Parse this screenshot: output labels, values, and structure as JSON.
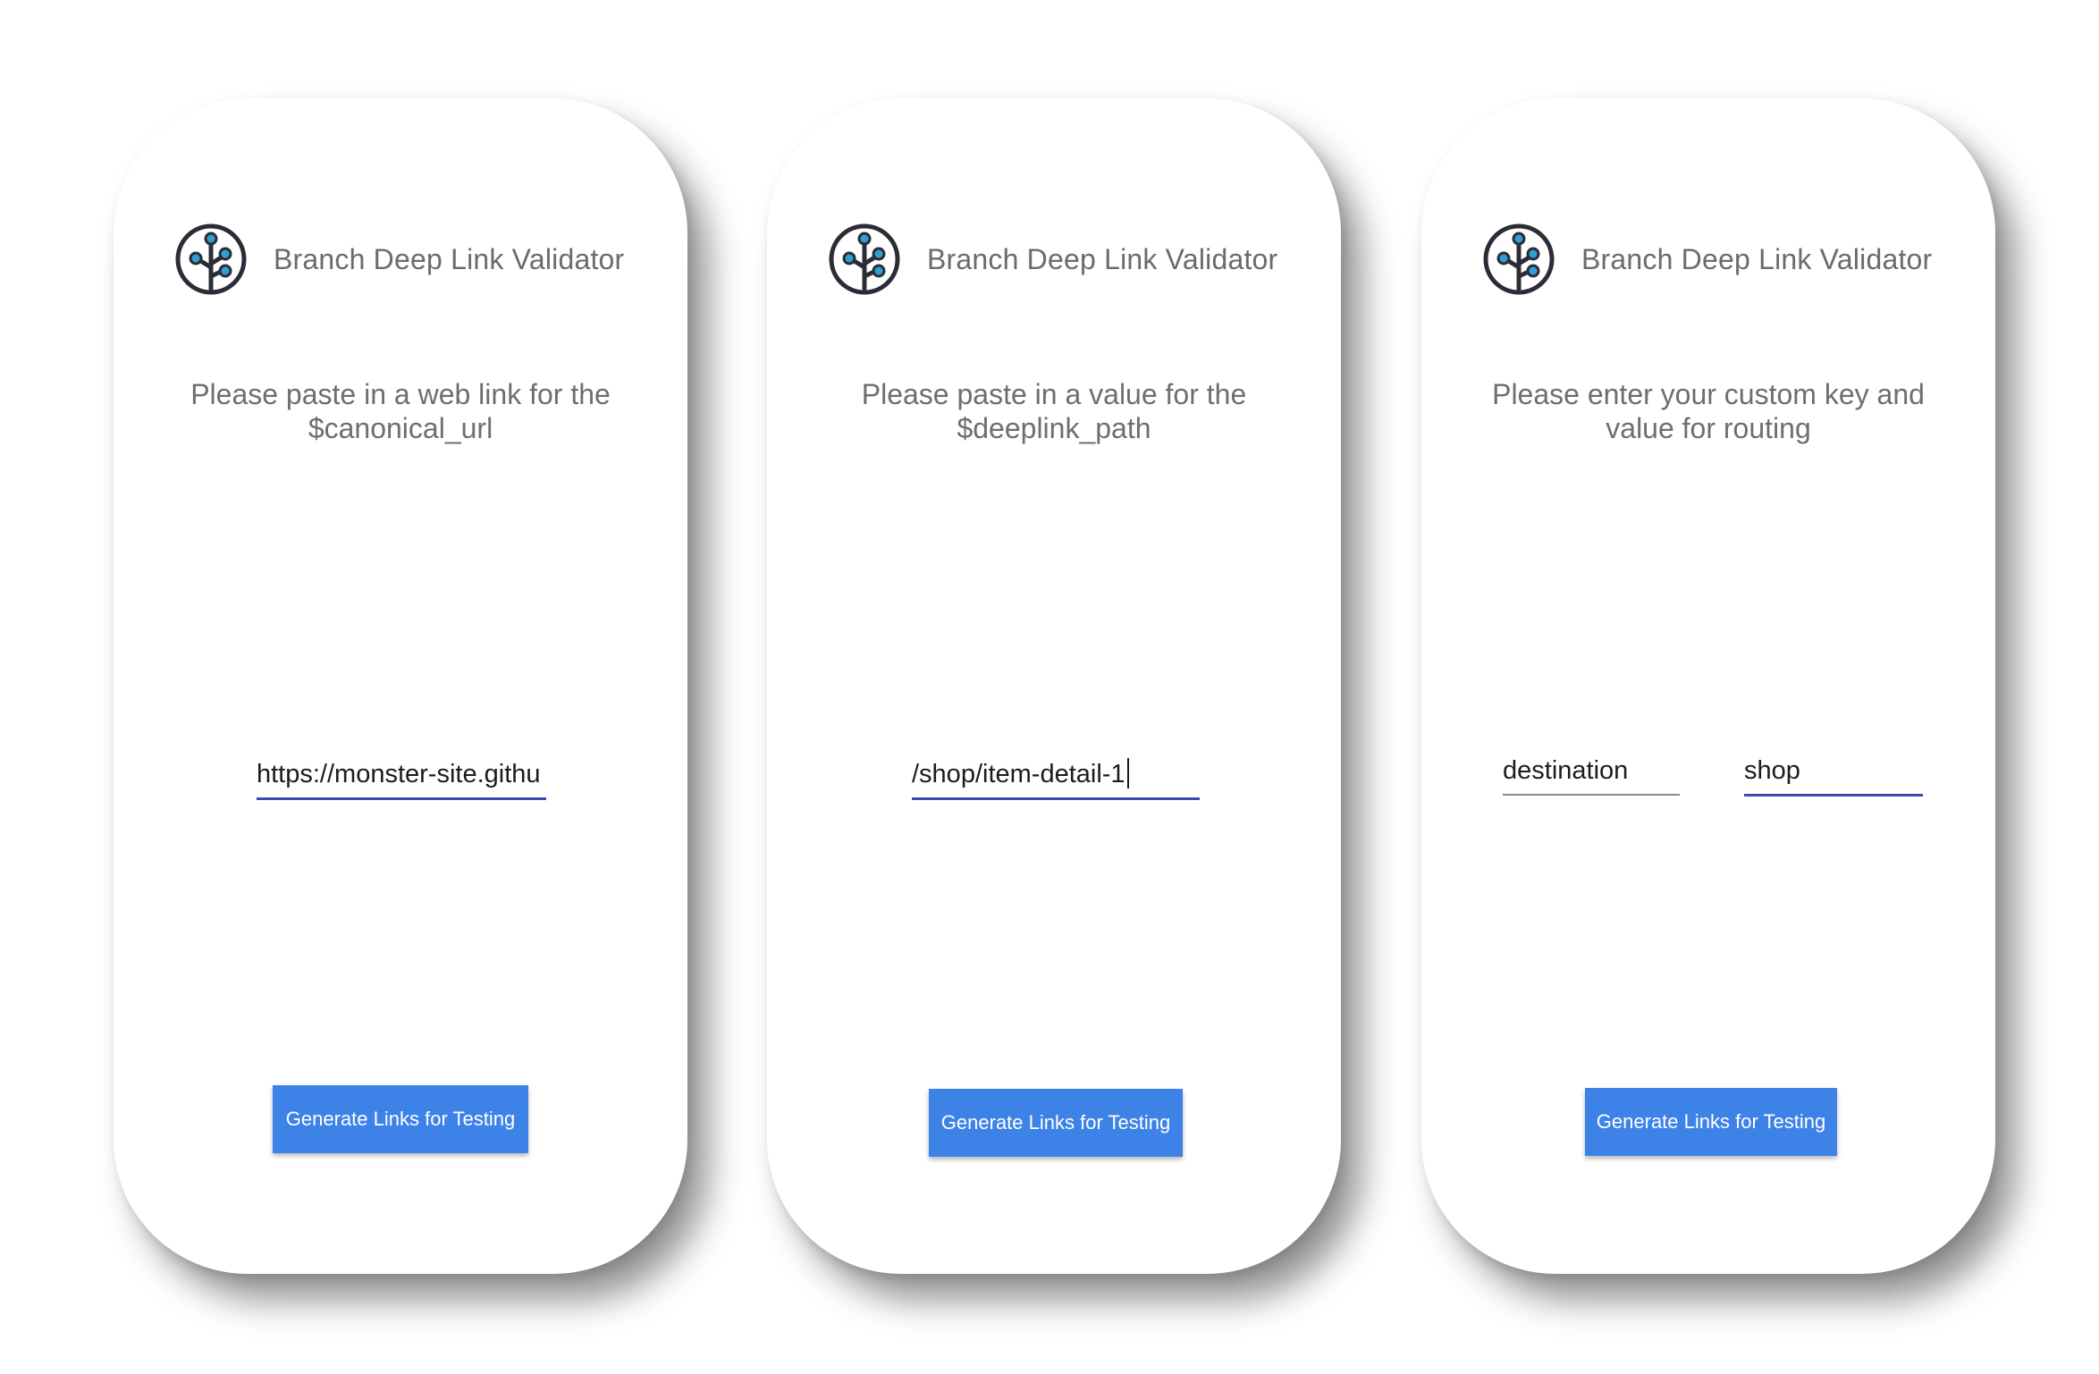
{
  "app": {
    "title": "Branch Deep Link Validator",
    "logo_icon": "branch-tree-icon",
    "accent_color": "#3d82e7",
    "underline_color": "#3a4bb0"
  },
  "screens": [
    {
      "instruction": "Please paste in a web link for the $canonical_url",
      "input_value": "https://monster-site.githu",
      "button_label": "Generate Links for Testing"
    },
    {
      "instruction": "Please paste in a value for the $deeplink_path",
      "input_value": "/shop/item-detail-1",
      "button_label": "Generate Links for Testing"
    },
    {
      "instruction": "Please enter your custom key and value for routing",
      "key_value": "destination",
      "value_value": "shop",
      "button_label": "Generate Links for Testing"
    }
  ]
}
